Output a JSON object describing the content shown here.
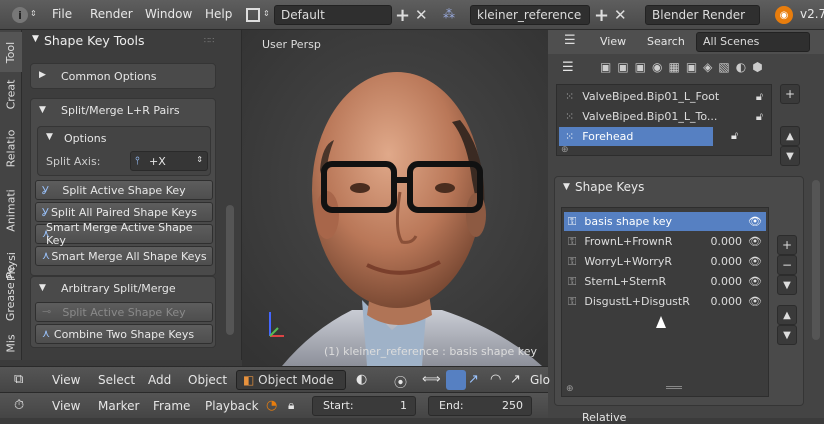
{
  "topbar": {
    "menus": [
      "File",
      "Render",
      "Window",
      "Help"
    ],
    "layout_value": "Default",
    "scene_value": "kleiner_reference",
    "engine_value": "Blender Render",
    "version": "v2.7"
  },
  "toolstrip": {
    "tabs": [
      "Tool",
      "Creat",
      "Relatio",
      "Animati",
      "Physi",
      "Grease Pe",
      "Mis"
    ]
  },
  "tool_panel": {
    "title": "Shape Key Tools",
    "common_options": "Common Options",
    "split_merge": "Split/Merge L+R Pairs",
    "options": "Options",
    "split_axis_label": "Split Axis:",
    "split_axis_value": "+X",
    "buttons": [
      "Split Active Shape Key",
      "Split All Paired Shape Keys",
      "Smart Merge Active Shape Key",
      "Smart Merge All Shape Keys"
    ],
    "arbitrary": "Arbitrary Split/Merge",
    "arbitrary_buttons": [
      "Split Active Shape Key",
      "Combine Two Shape Keys"
    ]
  },
  "viewport": {
    "label": "User Persp",
    "footer_text": "(1) kleiner_reference : basis shape key"
  },
  "bottom_bar1": {
    "items": [
      "View",
      "Select",
      "Add",
      "Object"
    ],
    "mode": "Object Mode",
    "glob": "Glo"
  },
  "bottom_bar2": {
    "items": [
      "View",
      "Marker",
      "Frame",
      "Playback"
    ],
    "start_label": "Start:",
    "start_value": "1",
    "end_label": "End:",
    "end_value": "250"
  },
  "right_panel": {
    "tabs": [
      "View",
      "Search"
    ],
    "scenes": "All Scenes",
    "vertex_groups": [
      "ValveBiped.Bip01_L_Foot",
      "ValveBiped.Bip01_L_To...",
      "Forehead"
    ],
    "shape_keys_title": "Shape Keys",
    "shape_keys": [
      {
        "name": "basis shape key",
        "value": ""
      },
      {
        "name": "FrownL+FrownR",
        "value": "0.000"
      },
      {
        "name": "WorryL+WorryR",
        "value": "0.000"
      },
      {
        "name": "SternL+SternR",
        "value": "0.000"
      },
      {
        "name": "DisgustL+DisgustR",
        "value": "0.000"
      }
    ],
    "relative_label": "Relative"
  },
  "colors": {
    "selection": "#5680c2",
    "accent_axis_x": "#d44",
    "accent_axis_y": "#5b5",
    "accent_axis_z": "#46f"
  }
}
